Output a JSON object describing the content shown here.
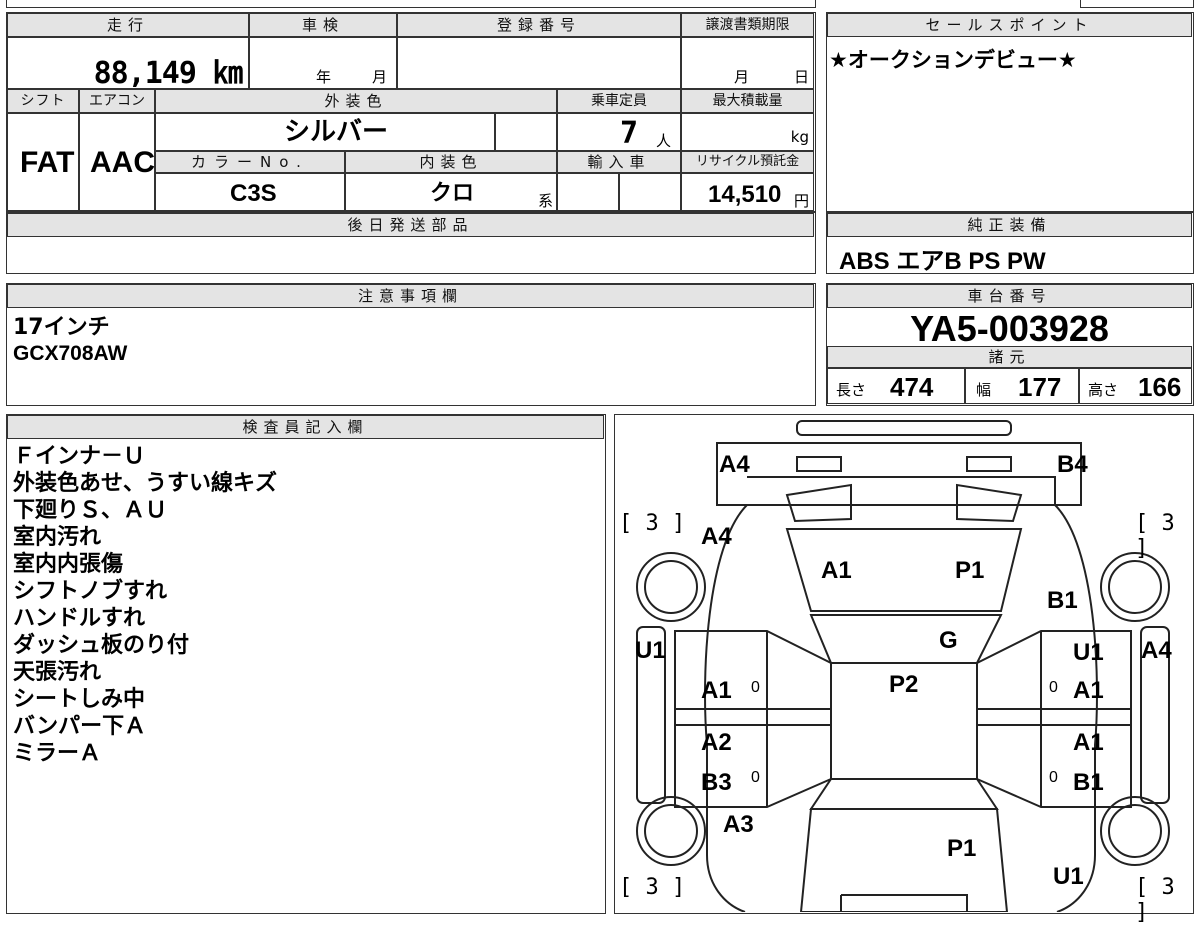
{
  "header": {
    "mileage_label": "走行",
    "inspection_label": "車検",
    "registration_label": "登録番号",
    "transfer_deadline_label": "譲渡書類期限",
    "sales_point_label": "セールスポイント",
    "shift_label": "シフト",
    "aircon_label": "エアコン",
    "exterior_color_label": "外装色",
    "capacity_label": "乗車定員",
    "max_load_label": "最大積載量",
    "color_no_label": "カラーNo.",
    "interior_color_label": "内装色",
    "import_label": "輸入車",
    "recycle_label": "リサイクル預託金",
    "later_parts_label": "後日発送部品",
    "factory_equipment_label": "純正装備",
    "notes_label": "注意事項欄",
    "chassis_label": "車台番号",
    "specs_label": "諸元",
    "inspector_label": "検査員記入欄"
  },
  "values": {
    "mileage": "88,149 ㎞",
    "inspection_year_unit": "年",
    "inspection_month_unit": "月",
    "deadline_month_unit": "月",
    "deadline_day_unit": "日",
    "sales_point": "★オークションデビュー★",
    "shift": "FAT",
    "aircon": "AAC",
    "exterior_color": "シルバー",
    "capacity": "7",
    "capacity_unit": "人",
    "max_load_unit": "kg",
    "color_no": "C3S",
    "interior_color": "クロ",
    "interior_suffix": "系",
    "recycle": "14,510",
    "recycle_unit": "円",
    "factory_equipment": "ABS エアB PS PW",
    "notes": [
      "17インチ",
      "GCX708AW"
    ],
    "chassis": "YA5-003928",
    "length_label": "長さ",
    "length": "474",
    "width_label": "幅",
    "width": "177",
    "height_label": "高さ",
    "height": "166",
    "inspector_notes": [
      "Ｆインナ－Ｕ",
      "外装色あせ、うすい線キズ",
      "下廻りＳ、ＡＵ",
      "室内汚れ",
      "室内内張傷",
      "シフトノブすれ",
      "ハンドルすれ",
      "ダッシュ板のり付",
      "天張汚れ",
      "シートしみ中",
      "バンパー下Ａ",
      "ミラーＡ"
    ]
  },
  "diagram": {
    "tl_tire": "[ 3 ]",
    "tr_tire": "[ 3 ]",
    "bl_tire": "[ 3 ]",
    "br_tire": "[ 3 ]",
    "labels": {
      "front_left_bumper": "A4",
      "front_right_bumper": "B4",
      "left_fender": "A4",
      "hood_left": "A1",
      "hood_right": "P1",
      "right_fender": "B1",
      "windshield": "G",
      "left_rocker": "U1",
      "right_pillar": "U1",
      "right_side_far": "A4",
      "roof": "P2",
      "front_left_door": "A1",
      "front_right_door": "A1",
      "rear_left_door_top": "A2",
      "rear_right_door_top": "A1",
      "rear_left_door": "B3",
      "rear_right_door": "B1",
      "rear_left_quarter": "A3",
      "tailgate": "P1",
      "rear_bumper_right": "U1",
      "zero_l1": "0",
      "zero_r1": "0",
      "zero_l2": "0",
      "zero_r2": "0"
    }
  }
}
